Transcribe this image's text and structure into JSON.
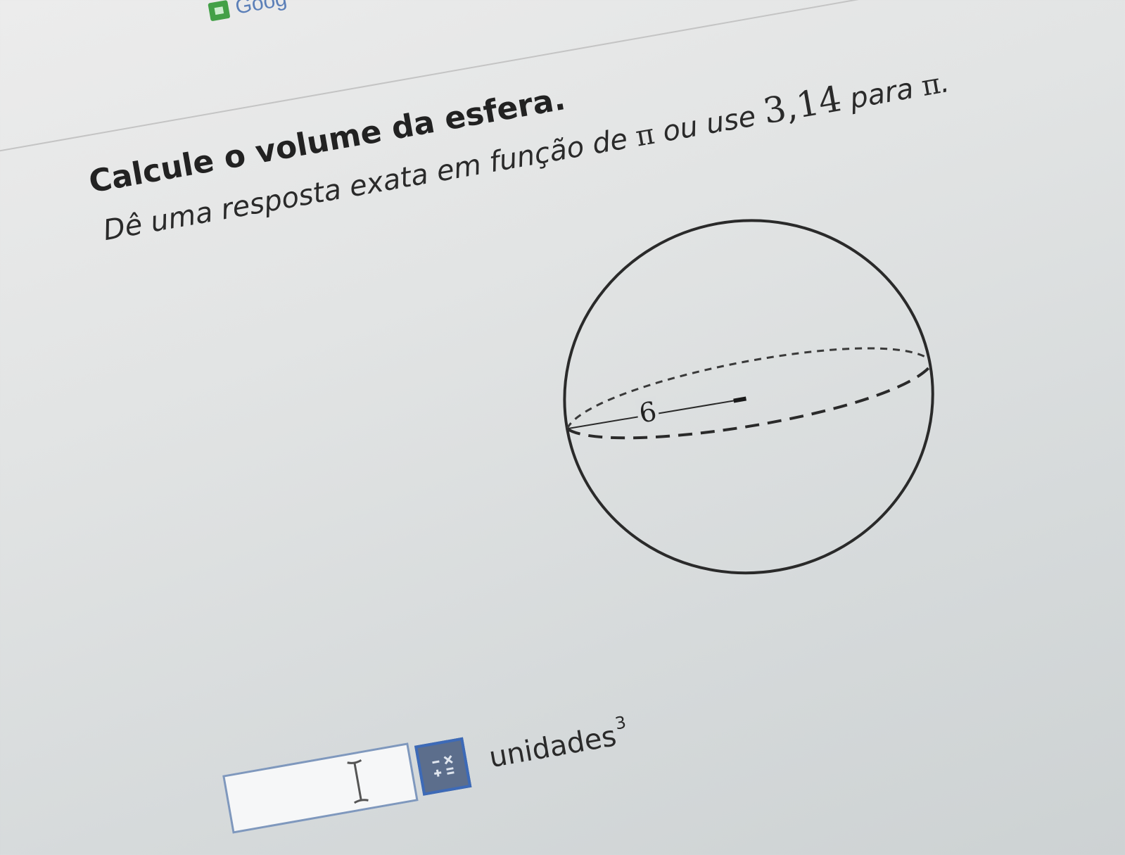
{
  "browser": {
    "tab_label": "Goog"
  },
  "question": {
    "title": "Calcule o volume da esfera.",
    "instruction_part1": "Dê uma resposta exata em função de ",
    "pi_symbol": "π",
    "instruction_part2": " ou use ",
    "approx_value": "3,14",
    "instruction_part3": " para ",
    "instruction_end": "."
  },
  "figure": {
    "radius_label": "6"
  },
  "answer": {
    "input_value": "",
    "unit": "unidades",
    "unit_exponent": "3"
  },
  "colors": {
    "input_border": "#7f98bd",
    "keypad_button": "#5c6e8c",
    "keypad_border": "#3d6ab7"
  }
}
